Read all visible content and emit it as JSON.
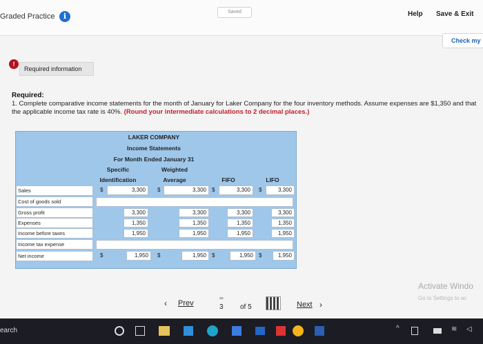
{
  "header": {
    "title": "Graded Practice",
    "saved": "Saved",
    "help": "Help",
    "save_exit": "Save & Exit",
    "check_my": "Check my"
  },
  "required_info": "Required information",
  "required": {
    "heading": "Required:",
    "text": "1. Complete comparative income statements for the month of January for Laker Company for the four inventory methods. Assume expenses are $1,350 and that the applicable income tax rate is 40%.",
    "highlight": "(Round your intermediate calculations to 2 decimal places.)"
  },
  "statement": {
    "company": "LAKER COMPANY",
    "title": "Income Statements",
    "period": "For Month Ended January 31",
    "columns": [
      {
        "line1": "Specific",
        "line2": "Identification"
      },
      {
        "line1": "Weighted",
        "line2": "Average"
      },
      {
        "line1": "",
        "line2": "FIFO"
      },
      {
        "line1": "",
        "line2": "LIFO"
      }
    ],
    "rows": [
      {
        "label": "Sales",
        "values": [
          "3,300",
          "3,300",
          "3,300",
          "3,300"
        ],
        "dollar": true
      },
      {
        "label": "Cost of goods sold",
        "values": [
          "",
          "",
          "",
          ""
        ],
        "dollar": false
      },
      {
        "label": "Gross profit",
        "values": [
          "3,300",
          "3,300",
          "3,300",
          "3,300"
        ],
        "dollar": false
      },
      {
        "label": "Expenses",
        "values": [
          "1,350",
          "1,350",
          "1,350",
          "1,350"
        ],
        "dollar": false
      },
      {
        "label": "Income before taxes",
        "values": [
          "1,950",
          "1,950",
          "1,950",
          "1,950"
        ],
        "dollar": false
      },
      {
        "label": "Income tax expense",
        "values": [
          "",
          "",
          "",
          ""
        ],
        "dollar": false
      },
      {
        "label": "Net income",
        "values": [
          "1,950",
          "1,950",
          "1,950",
          "1,950"
        ],
        "dollar": true
      }
    ],
    "dollar_sign": "$"
  },
  "pager": {
    "prev": "Prev",
    "current": "3",
    "of": "of 5",
    "next": "Next"
  },
  "watermark": {
    "title": "Activate Windo",
    "subtitle": "Go to Settings to ac"
  },
  "taskbar": {
    "search": "earch"
  },
  "colors": {
    "table_bg": "#9fc7ea",
    "highlight": "#c0202b",
    "info_blue": "#1f6fd0",
    "alert_red": "#b5121b"
  }
}
